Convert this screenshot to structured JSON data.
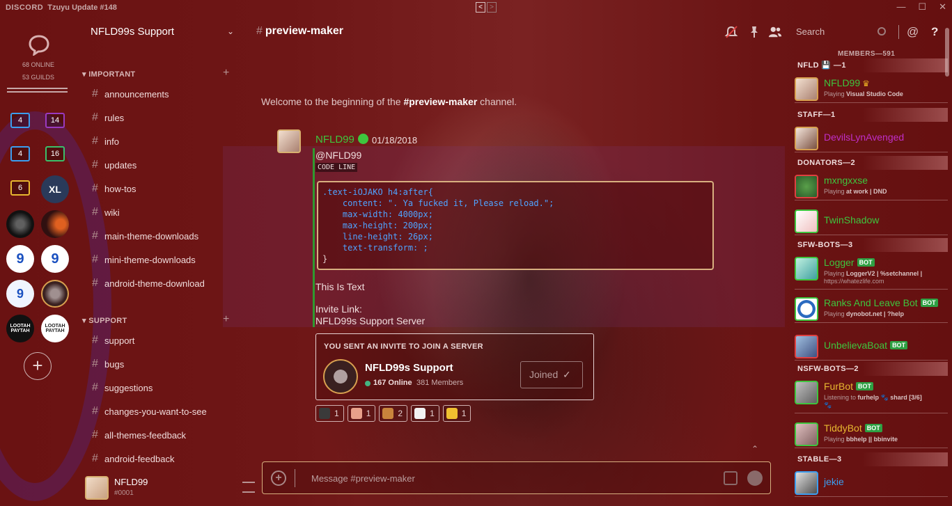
{
  "app": {
    "brand": "DISCORD",
    "window_title": "Tzuyu Update #148",
    "nav_back": "<",
    "nav_forward": ">",
    "window_controls": [
      "—",
      "☐",
      "✕"
    ]
  },
  "guild_bar": {
    "online": "68 ONLINE",
    "guilds": "53 GUILDS",
    "folders": [
      {
        "count": "4",
        "color": "#3b9ef0"
      },
      {
        "count": "14",
        "color": "#9a3ac0"
      },
      {
        "count": "4",
        "color": "#3b9ef0"
      },
      {
        "count": "16",
        "color": "#3bbf6a"
      },
      {
        "count": "6",
        "color": "#e8b830"
      }
    ],
    "icon_texts": [
      "XL",
      "LOOTAH PAYTAH",
      "LOOTAH PAYTAH"
    ],
    "add_label": "+"
  },
  "sidebar": {
    "server_name": "NFLD99s Support",
    "categories": [
      {
        "label": "IMPORTANT",
        "channels": [
          "announcements",
          "rules",
          "info",
          "updates",
          "how-tos",
          "wiki",
          "main-theme-downloads",
          "mini-theme-downloads",
          "android-theme-download"
        ]
      },
      {
        "label": "SUPPORT",
        "channels": [
          "support",
          "bugs",
          "suggestions",
          "changes-you-want-to-see",
          "all-themes-feedback",
          "android-feedback"
        ]
      }
    ],
    "user": {
      "name": "NFLD99",
      "tag": "#0001"
    }
  },
  "header": {
    "channel": "preview-maker",
    "search_placeholder": "Search"
  },
  "chat": {
    "welcome_prefix": "Welcome to the beginning of the ",
    "welcome_channel": "#preview-maker",
    "welcome_suffix": " channel.",
    "message": {
      "author": "NFLD99",
      "date": "01/18/2018",
      "mention": "@NFLD99",
      "inline_code": "CODE LINE",
      "code_lines": [
        ".text-iOJAKO h4:after{",
        "    content: \". Ya fucked it, Please reload.\";",
        "    max-width: 4000px;",
        "    max-height: 200px;",
        "    line-height: 26px;",
        "    text-transform: ;",
        "}"
      ],
      "text": "This Is Text",
      "invite_label": "Invite Link:",
      "invite_server_line": "NFLD99s Support Server"
    },
    "invite": {
      "heading": "YOU SENT AN INVITE TO JOIN A SERVER",
      "server": "NFLD99s Support",
      "online": "167 Online",
      "members": "381 Members",
      "button": "Joined",
      "button_check": "✓"
    },
    "reactions": [
      {
        "count": "1",
        "color": "#3a3a3a"
      },
      {
        "count": "1",
        "color": "#e8a08a"
      },
      {
        "count": "2",
        "color": "#c8843c"
      },
      {
        "count": "1",
        "color": "#f2f2f2"
      },
      {
        "count": "1",
        "color": "#f0c030"
      }
    ],
    "composer_placeholder": "Message #preview-maker"
  },
  "members": {
    "count_label": "MEMBERS—591",
    "groups": [
      {
        "label": "NFLD 💾 —1",
        "members": [
          {
            "name": "NFLD99",
            "color": "#3ec53e",
            "crown": "♛",
            "status_prefix": "Playing ",
            "status": "Visual Studio Code",
            "status2": "",
            "bot": ""
          }
        ]
      },
      {
        "label": "STAFF—1",
        "members": [
          {
            "name": "DevilsLynAvenged",
            "color": "#c02ec8",
            "crown": "",
            "status_prefix": "",
            "status": "",
            "status2": "",
            "bot": ""
          }
        ]
      },
      {
        "label": "DONATORS—2",
        "members": [
          {
            "name": "mxngxxse",
            "color": "#3ec53e",
            "crown": "",
            "status_prefix": "Playing ",
            "status": "at work | DND",
            "status2": "",
            "bot": ""
          },
          {
            "name": "TwinShadow",
            "color": "#3ec53e",
            "crown": "",
            "status_prefix": "",
            "status": "",
            "status2": "",
            "bot": ""
          }
        ]
      },
      {
        "label": "SFW-BOTS—3",
        "members": [
          {
            "name": "Logger",
            "color": "#3ec53e",
            "crown": "",
            "status_prefix": "Playing ",
            "status": "LoggerV2 | %setchannel |",
            "status2": "https://whatezlife.com",
            "bot": "BOT"
          },
          {
            "name": "Ranks And Leave Bot",
            "color": "#3ec53e",
            "crown": "",
            "status_prefix": "Playing ",
            "status": "dynobot.net | ?help",
            "status2": "",
            "bot": "BOT"
          },
          {
            "name": "UnbelievaBoat",
            "color": "#3ec53e",
            "crown": "",
            "status_prefix": "",
            "status": "",
            "status2": "",
            "bot": "BOT"
          }
        ]
      },
      {
        "label": "NSFW-BOTS—2",
        "members": [
          {
            "name": "FurBot",
            "color": "#e8b830",
            "crown": "",
            "status_prefix": "Listening to ",
            "status": "furhelp 🐾 shard [3/6]",
            "status2": "🐾",
            "bot": "BOT"
          },
          {
            "name": "TiddyBot",
            "color": "#e8b830",
            "crown": "",
            "status_prefix": "Playing ",
            "status": "bbhelp || bbinvite",
            "status2": "",
            "bot": "BOT"
          }
        ]
      },
      {
        "label": "STABLE—3",
        "members": [
          {
            "name": "jekie",
            "color": "#3b9ef0",
            "crown": "",
            "status_prefix": "",
            "status": "",
            "status2": "",
            "bot": ""
          }
        ]
      }
    ]
  }
}
